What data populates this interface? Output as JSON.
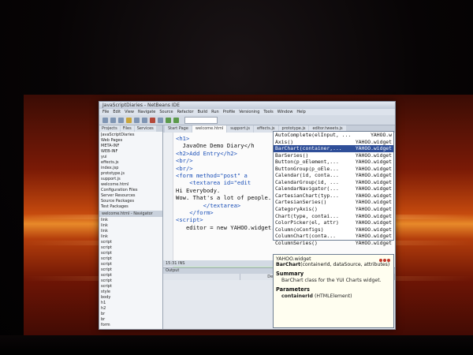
{
  "window": {
    "title": "JavaScriptDiaries - NetBeans IDE"
  },
  "menu": [
    "File",
    "Edit",
    "View",
    "Navigate",
    "Source",
    "Refactor",
    "Build",
    "Run",
    "Profile",
    "Versioning",
    "Tools",
    "Window",
    "Help"
  ],
  "left_panel": {
    "tabs": [
      "Projects",
      "Files",
      "Services"
    ],
    "tree": [
      "JavaScriptDiaries",
      "Web Pages",
      "META-INF",
      "WEB-INF",
      "yui",
      "effects.js",
      "index.jsp",
      "prototype.js",
      "support.js",
      "welcome.html",
      "Configuration Files",
      "Server Resources",
      "Source Packages",
      "Test Packages"
    ],
    "navigator_title": "welcome.html - Navigator",
    "navigator": [
      "link",
      "link",
      "link",
      "link",
      "script",
      "script",
      "script",
      "script",
      "script",
      "script",
      "script",
      "script",
      "script",
      "style",
      "body",
      "h1",
      "h2",
      "br",
      "br",
      "form"
    ]
  },
  "editor": {
    "tabs": [
      "Start Page",
      "welcome.html",
      "support.js",
      "effects.js",
      "prototype.js",
      "editor.tweets.js"
    ],
    "code_lines": [
      "<h1>",
      "  JavaOne Demo Diary</h",
      "<h2>Add Entry</h2>",
      "<br/>",
      "<br/>",
      "",
      "<form method=\"post\" a",
      "",
      "    <textarea id=\"edit",
      "Hi Everybody.",
      "Wow. That's a lot of people.",
      "        </textarea>",
      "",
      "    </form>",
      "",
      "<script>",
      "   editor = new YAHOO.widget."
    ],
    "status": "15:31   INS"
  },
  "autocomplete": {
    "items": [
      {
        "name": "AutoComplete(elInput, ...",
        "pkg": "YAHOO.w"
      },
      {
        "name": "Axis()",
        "pkg": "YAHOO.widget"
      },
      {
        "name": "BarChart(container,...",
        "pkg": "YAHOO.widget"
      },
      {
        "name": "BarSeries()",
        "pkg": "YAHOO.widget"
      },
      {
        "name": "Button(p_oElement,...",
        "pkg": "YAHOO.widget"
      },
      {
        "name": "ButtonGroup(p_oEle...",
        "pkg": "YAHOO.widget"
      },
      {
        "name": "Calendar(id, conta...",
        "pkg": "YAHOO.widget"
      },
      {
        "name": "CalendarGroup(id, ...",
        "pkg": "YAHOO.widget"
      },
      {
        "name": "CalendarNavigator(...",
        "pkg": "YAHOO.widget"
      },
      {
        "name": "CartesianChart(typ...",
        "pkg": "YAHOO.widget"
      },
      {
        "name": "CartesianSeries()",
        "pkg": "YAHOO.widget"
      },
      {
        "name": "CategoryAxis()",
        "pkg": "YAHOO.widget"
      },
      {
        "name": "Chart(type, contai...",
        "pkg": "YAHOO.widget"
      },
      {
        "name": "ColorPicker(el, attr)",
        "pkg": "YAHOO.widget"
      },
      {
        "name": "Column(oConfigs)",
        "pkg": "YAHOO.widget"
      },
      {
        "name": "ColumnChart(conta...",
        "pkg": "YAHOO.widget"
      },
      {
        "name": "ColumnSeries()",
        "pkg": "YAHOO.widget"
      }
    ],
    "selected_index": 2
  },
  "doc_popup": {
    "package": "YAHOO.widget",
    "signature_name": "BarChart",
    "signature_params": "(containerId, dataSource, attributes)",
    "summary_heading": "Summary",
    "summary_text": "BarChart class for the YUI Charts widget.",
    "params_heading": "Parameters",
    "param_name": "containerId",
    "param_type": "(HTMLElement)"
  },
  "lower_panel": {
    "title": "Output",
    "columns": [
      "",
      "Description",
      ""
    ]
  }
}
